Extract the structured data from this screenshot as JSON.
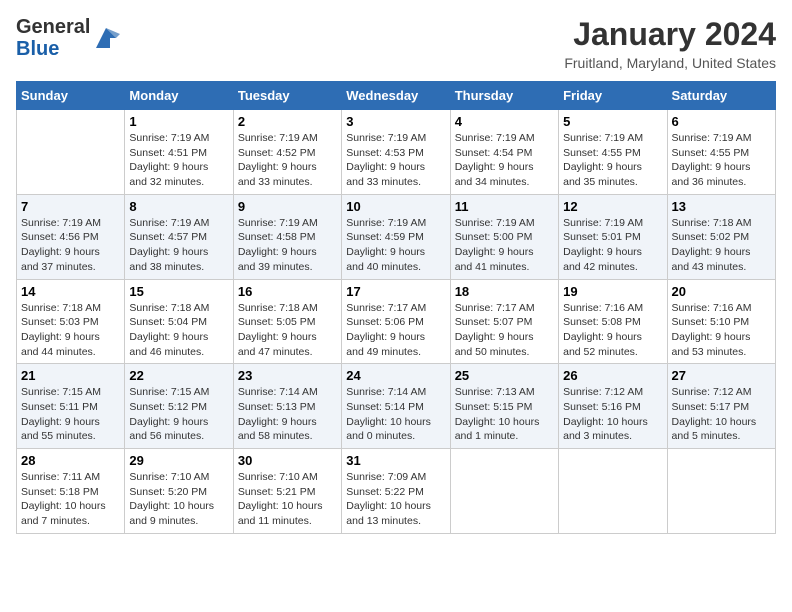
{
  "header": {
    "logo_general": "General",
    "logo_blue": "Blue",
    "month_title": "January 2024",
    "location": "Fruitland, Maryland, United States"
  },
  "days_of_week": [
    "Sunday",
    "Monday",
    "Tuesday",
    "Wednesday",
    "Thursday",
    "Friday",
    "Saturday"
  ],
  "weeks": [
    [
      {
        "day": "",
        "info": ""
      },
      {
        "day": "1",
        "info": "Sunrise: 7:19 AM\nSunset: 4:51 PM\nDaylight: 9 hours\nand 32 minutes."
      },
      {
        "day": "2",
        "info": "Sunrise: 7:19 AM\nSunset: 4:52 PM\nDaylight: 9 hours\nand 33 minutes."
      },
      {
        "day": "3",
        "info": "Sunrise: 7:19 AM\nSunset: 4:53 PM\nDaylight: 9 hours\nand 33 minutes."
      },
      {
        "day": "4",
        "info": "Sunrise: 7:19 AM\nSunset: 4:54 PM\nDaylight: 9 hours\nand 34 minutes."
      },
      {
        "day": "5",
        "info": "Sunrise: 7:19 AM\nSunset: 4:55 PM\nDaylight: 9 hours\nand 35 minutes."
      },
      {
        "day": "6",
        "info": "Sunrise: 7:19 AM\nSunset: 4:55 PM\nDaylight: 9 hours\nand 36 minutes."
      }
    ],
    [
      {
        "day": "7",
        "info": "Sunrise: 7:19 AM\nSunset: 4:56 PM\nDaylight: 9 hours\nand 37 minutes."
      },
      {
        "day": "8",
        "info": "Sunrise: 7:19 AM\nSunset: 4:57 PM\nDaylight: 9 hours\nand 38 minutes."
      },
      {
        "day": "9",
        "info": "Sunrise: 7:19 AM\nSunset: 4:58 PM\nDaylight: 9 hours\nand 39 minutes."
      },
      {
        "day": "10",
        "info": "Sunrise: 7:19 AM\nSunset: 4:59 PM\nDaylight: 9 hours\nand 40 minutes."
      },
      {
        "day": "11",
        "info": "Sunrise: 7:19 AM\nSunset: 5:00 PM\nDaylight: 9 hours\nand 41 minutes."
      },
      {
        "day": "12",
        "info": "Sunrise: 7:19 AM\nSunset: 5:01 PM\nDaylight: 9 hours\nand 42 minutes."
      },
      {
        "day": "13",
        "info": "Sunrise: 7:18 AM\nSunset: 5:02 PM\nDaylight: 9 hours\nand 43 minutes."
      }
    ],
    [
      {
        "day": "14",
        "info": "Sunrise: 7:18 AM\nSunset: 5:03 PM\nDaylight: 9 hours\nand 44 minutes."
      },
      {
        "day": "15",
        "info": "Sunrise: 7:18 AM\nSunset: 5:04 PM\nDaylight: 9 hours\nand 46 minutes."
      },
      {
        "day": "16",
        "info": "Sunrise: 7:18 AM\nSunset: 5:05 PM\nDaylight: 9 hours\nand 47 minutes."
      },
      {
        "day": "17",
        "info": "Sunrise: 7:17 AM\nSunset: 5:06 PM\nDaylight: 9 hours\nand 49 minutes."
      },
      {
        "day": "18",
        "info": "Sunrise: 7:17 AM\nSunset: 5:07 PM\nDaylight: 9 hours\nand 50 minutes."
      },
      {
        "day": "19",
        "info": "Sunrise: 7:16 AM\nSunset: 5:08 PM\nDaylight: 9 hours\nand 52 minutes."
      },
      {
        "day": "20",
        "info": "Sunrise: 7:16 AM\nSunset: 5:10 PM\nDaylight: 9 hours\nand 53 minutes."
      }
    ],
    [
      {
        "day": "21",
        "info": "Sunrise: 7:15 AM\nSunset: 5:11 PM\nDaylight: 9 hours\nand 55 minutes."
      },
      {
        "day": "22",
        "info": "Sunrise: 7:15 AM\nSunset: 5:12 PM\nDaylight: 9 hours\nand 56 minutes."
      },
      {
        "day": "23",
        "info": "Sunrise: 7:14 AM\nSunset: 5:13 PM\nDaylight: 9 hours\nand 58 minutes."
      },
      {
        "day": "24",
        "info": "Sunrise: 7:14 AM\nSunset: 5:14 PM\nDaylight: 10 hours\nand 0 minutes."
      },
      {
        "day": "25",
        "info": "Sunrise: 7:13 AM\nSunset: 5:15 PM\nDaylight: 10 hours\nand 1 minute."
      },
      {
        "day": "26",
        "info": "Sunrise: 7:12 AM\nSunset: 5:16 PM\nDaylight: 10 hours\nand 3 minutes."
      },
      {
        "day": "27",
        "info": "Sunrise: 7:12 AM\nSunset: 5:17 PM\nDaylight: 10 hours\nand 5 minutes."
      }
    ],
    [
      {
        "day": "28",
        "info": "Sunrise: 7:11 AM\nSunset: 5:18 PM\nDaylight: 10 hours\nand 7 minutes."
      },
      {
        "day": "29",
        "info": "Sunrise: 7:10 AM\nSunset: 5:20 PM\nDaylight: 10 hours\nand 9 minutes."
      },
      {
        "day": "30",
        "info": "Sunrise: 7:10 AM\nSunset: 5:21 PM\nDaylight: 10 hours\nand 11 minutes."
      },
      {
        "day": "31",
        "info": "Sunrise: 7:09 AM\nSunset: 5:22 PM\nDaylight: 10 hours\nand 13 minutes."
      },
      {
        "day": "",
        "info": ""
      },
      {
        "day": "",
        "info": ""
      },
      {
        "day": "",
        "info": ""
      }
    ]
  ]
}
